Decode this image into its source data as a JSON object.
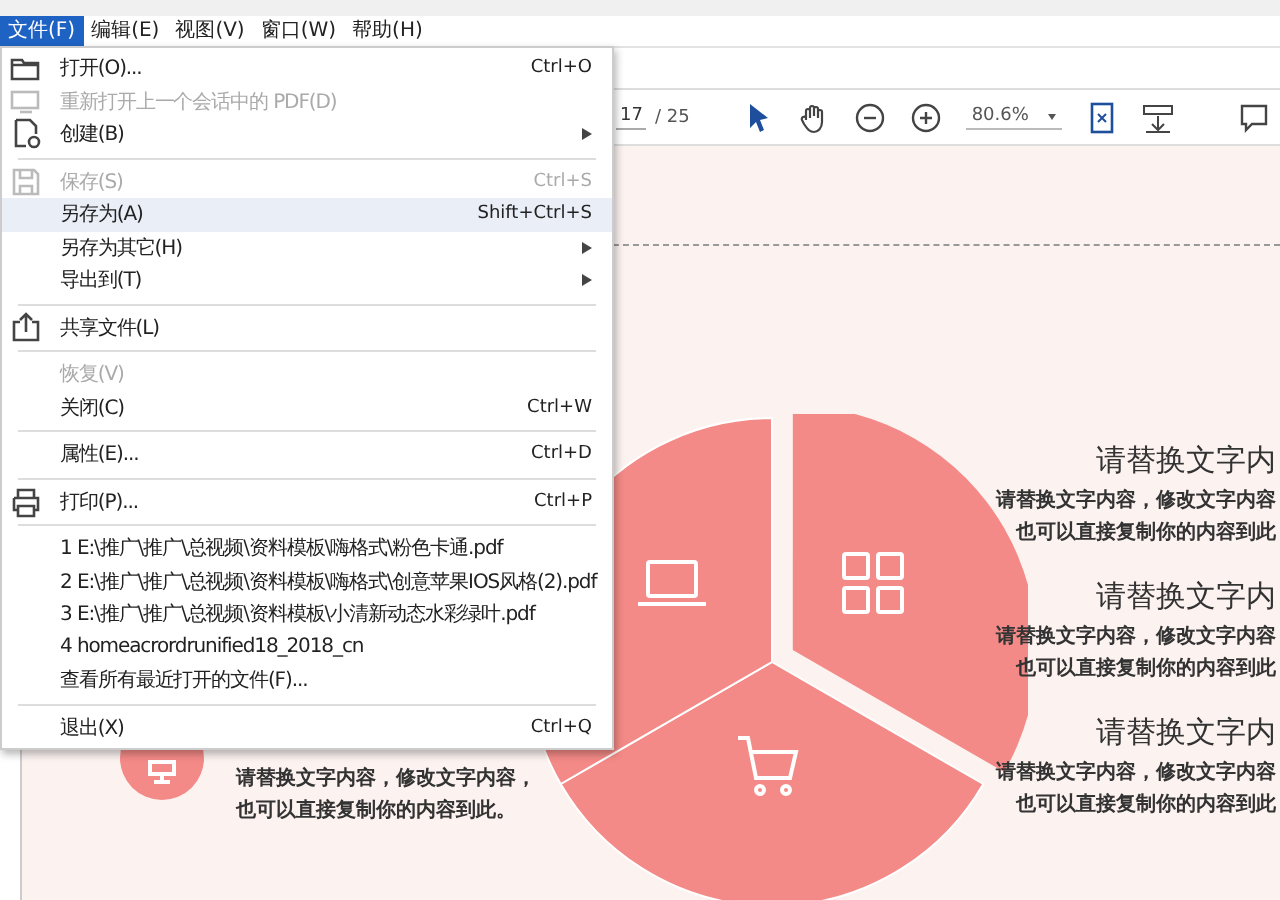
{
  "menu_bar": [
    {
      "label": "文件(F)",
      "selected": true
    },
    {
      "label": "编辑(E)",
      "selected": false
    },
    {
      "label": "视图(V)",
      "selected": false
    },
    {
      "label": "窗口(W)",
      "selected": false
    },
    {
      "label": "帮助(H)",
      "selected": false
    }
  ],
  "file_menu": {
    "groups": [
      [
        {
          "label": "打开(O)...",
          "shortcut": "Ctrl+O",
          "disabled": false,
          "submenu": false,
          "selected": false
        },
        {
          "label": "重新打开上一个会话中的 PDF(D)",
          "disabled": true,
          "submenu": false,
          "selected": false
        },
        {
          "label": "创建(B)",
          "disabled": false,
          "submenu": true,
          "selected": false
        }
      ],
      [
        {
          "label": "保存(S)",
          "shortcut": "Ctrl+S",
          "disabled": true,
          "submenu": false,
          "selected": false
        },
        {
          "label": "另存为(A)",
          "shortcut": "Shift+Ctrl+S",
          "disabled": false,
          "submenu": false,
          "selected": true
        },
        {
          "label": "另存为其它(H)",
          "disabled": false,
          "submenu": true,
          "selected": false
        },
        {
          "label": "导出到(T)",
          "disabled": false,
          "submenu": true,
          "selected": false
        }
      ],
      [
        {
          "label": "共享文件(L)",
          "disabled": false,
          "submenu": false,
          "selected": false
        }
      ],
      [
        {
          "label": "恢复(V)",
          "disabled": true,
          "submenu": false,
          "selected": false
        },
        {
          "label": "关闭(C)",
          "shortcut": "Ctrl+W",
          "disabled": false,
          "submenu": false,
          "selected": false
        }
      ],
      [
        {
          "label": "属性(E)...",
          "shortcut": "Ctrl+D",
          "disabled": false,
          "submenu": false,
          "selected": false
        }
      ],
      [
        {
          "label": "打印(P)...",
          "shortcut": "Ctrl+P",
          "disabled": false,
          "submenu": false,
          "selected": false
        }
      ],
      [
        {
          "label": "1 E:\\推广\\推广\\总视频\\资料模板\\嗨格式\\粉色卡通.pdf",
          "disabled": false,
          "submenu": false,
          "selected": false
        },
        {
          "label": "2 E:\\推广\\推广\\总视频\\资料模板\\嗨格式\\创意苹果IOS风格(2).pdf",
          "disabled": false,
          "submenu": false,
          "selected": false
        },
        {
          "label": "3 E:\\推广\\推广\\总视频\\资料模板\\小清新动态水彩绿叶.pdf",
          "disabled": false,
          "submenu": false,
          "selected": false
        },
        {
          "label": "4 homeacrordrunified18_2018_cn",
          "disabled": false,
          "submenu": false,
          "selected": false
        },
        {
          "label": "查看所有最近打开的文件(F)...",
          "disabled": false,
          "submenu": false,
          "selected": false
        }
      ],
      [
        {
          "label": "退出(X)",
          "shortcut": "Ctrl+Q",
          "disabled": false,
          "submenu": false,
          "selected": false
        }
      ]
    ]
  },
  "toolbar": {
    "page": "17",
    "page_total": "/ 25",
    "zoom": "80.6%"
  },
  "slide": {
    "left_block": {
      "lines": [
        "请替换文字内容，修改文字内容，",
        "也可以直接复制你的内容到此。"
      ]
    },
    "right_blocks": [
      {
        "title": "请替换文字内",
        "lines": [
          "请替换文字内容，修改文字内容",
          "也可以直接复制你的内容到此"
        ]
      },
      {
        "title": "请替换文字内",
        "lines": [
          "请替换文字内容，修改文字内容",
          "也可以直接复制你的内容到此"
        ]
      },
      {
        "title": "请替换文字内",
        "lines": [
          "请替换文字内容，修改文字内容",
          "也可以直接复制你的内容到此"
        ]
      }
    ]
  }
}
